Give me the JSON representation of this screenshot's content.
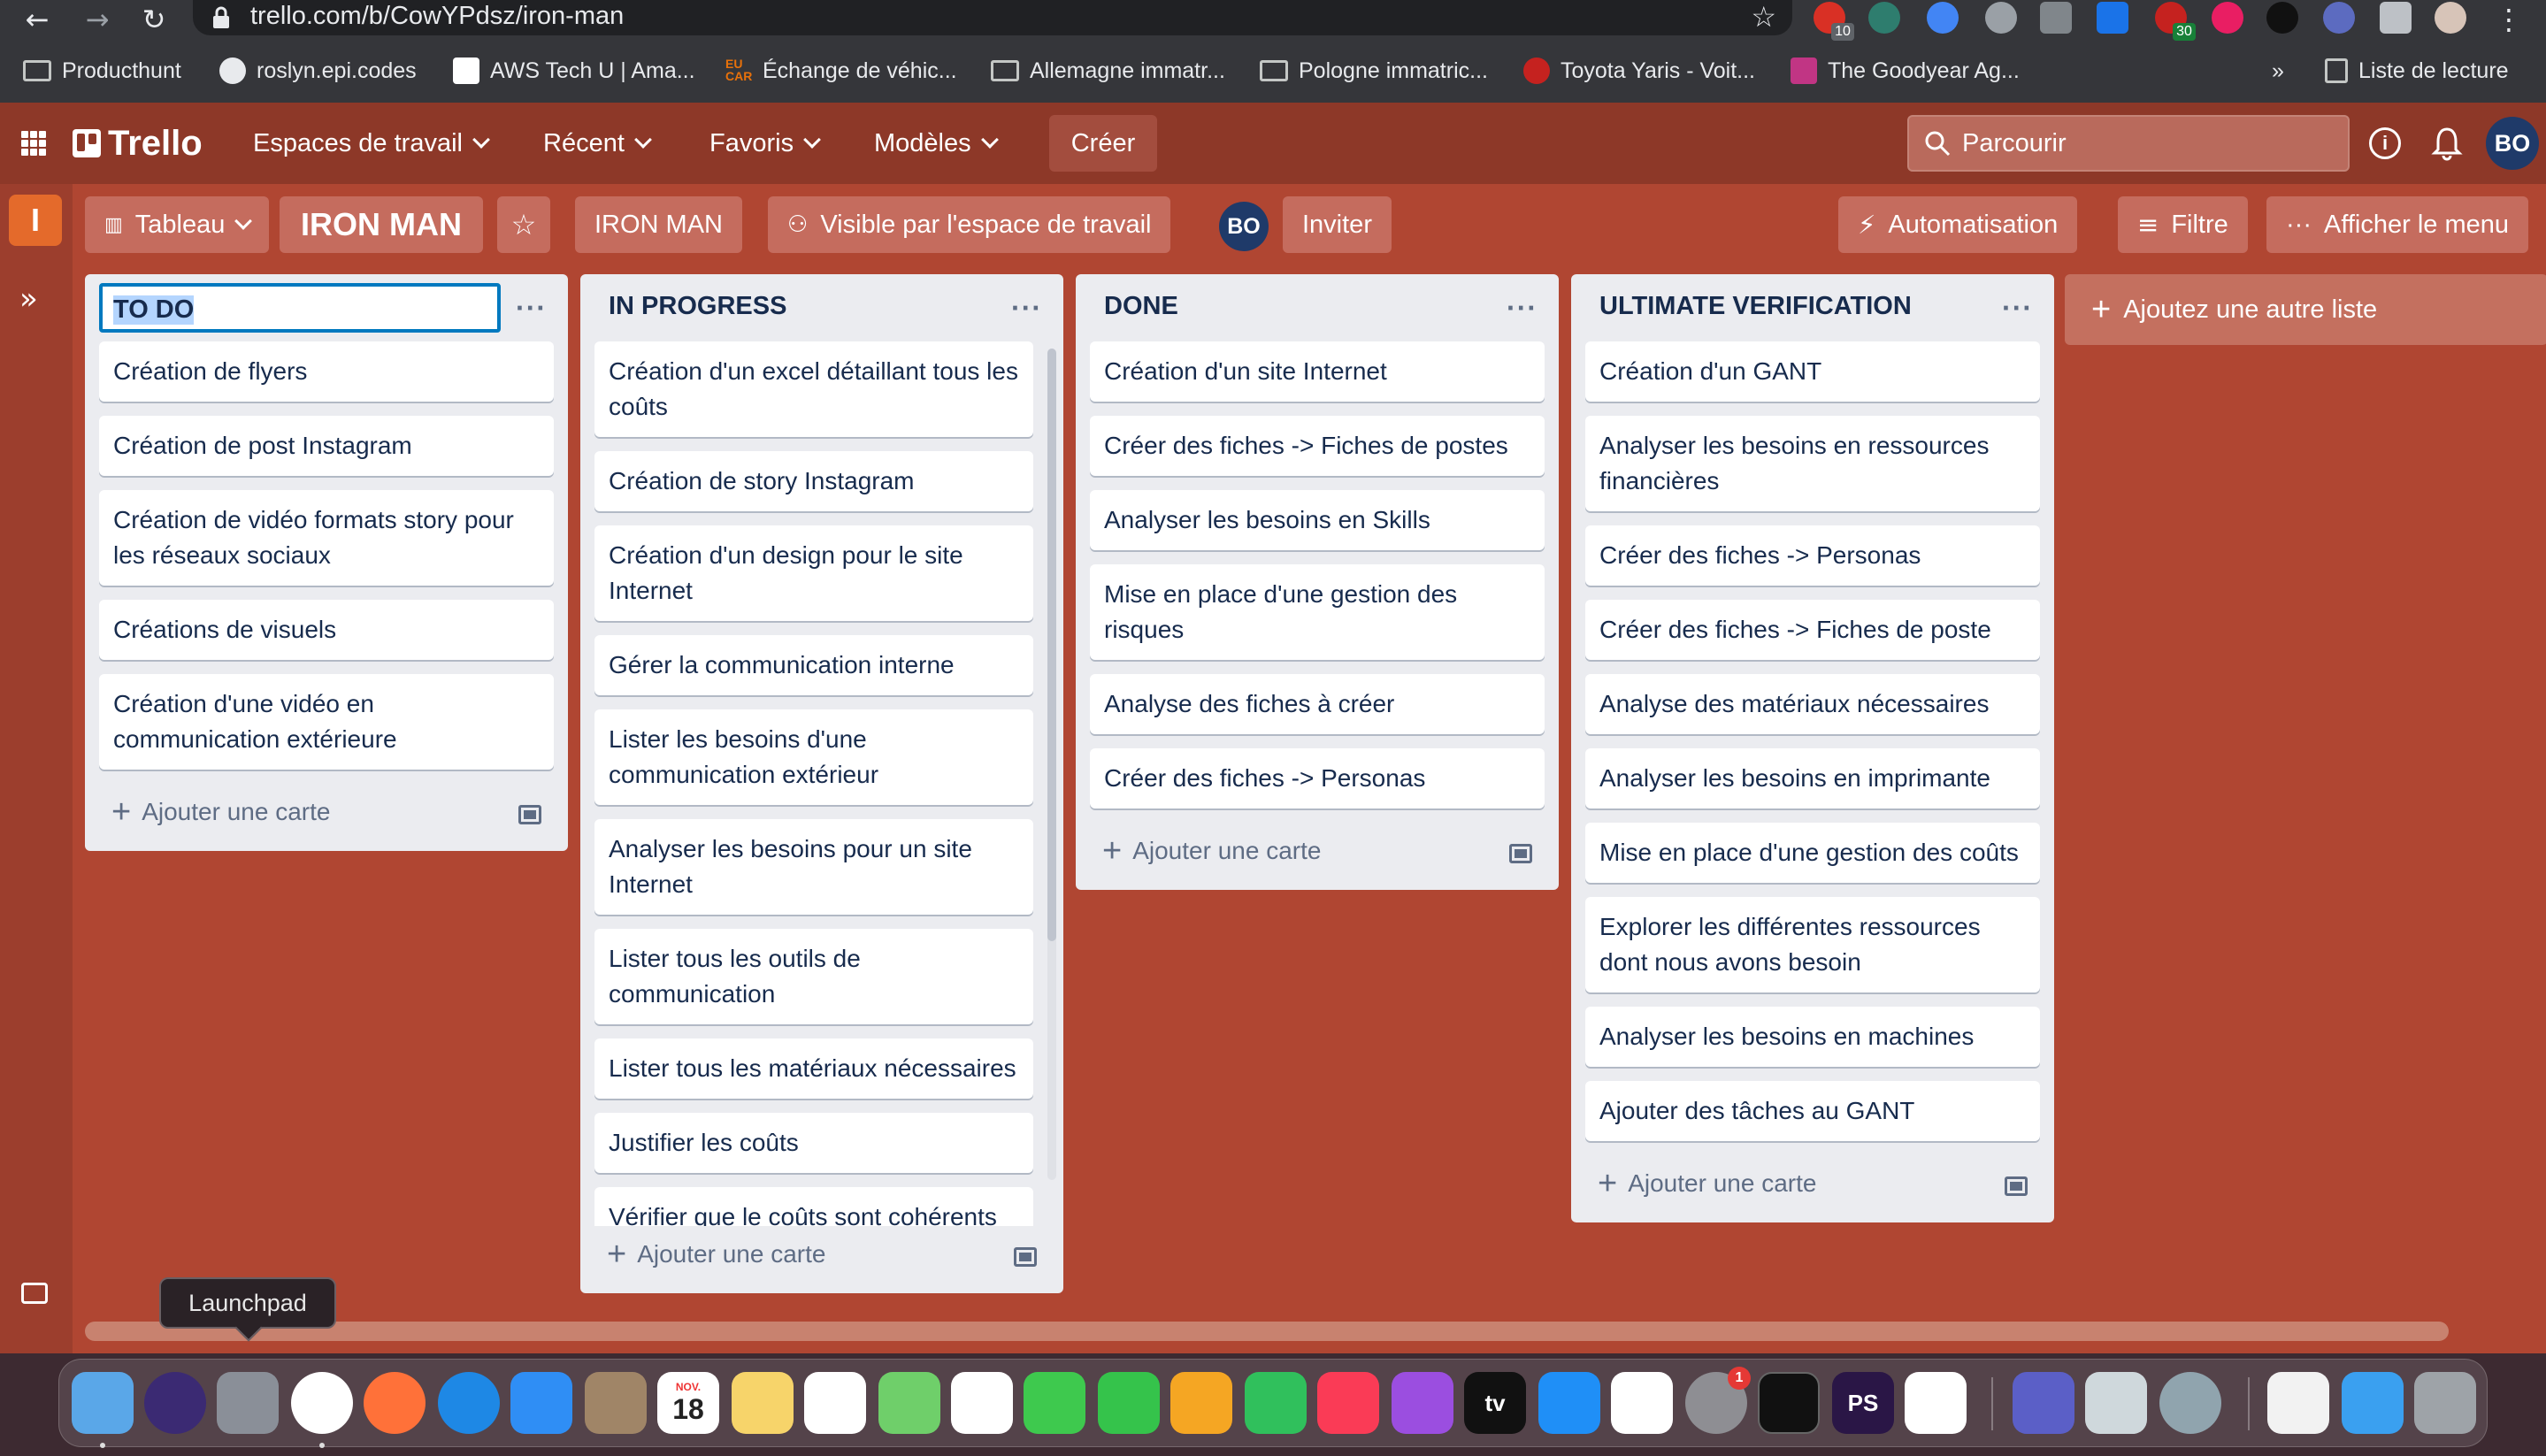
{
  "browser": {
    "url": "trello.com/b/CowYPdsz/iron-man",
    "extension_badges": [
      "10",
      "30"
    ],
    "bookmarks": [
      "Producthunt",
      "roslyn.epi.codes",
      "AWS Tech U | Ama...",
      "Échange de véhic...",
      "Allemagne immatr...",
      "Pologne immatric...",
      "Toyota Yaris - Voit...",
      "The Goodyear Ag..."
    ],
    "bookmarks_overflow": "»",
    "reading_list": "Liste de lecture",
    "eu_label": "EU\nCAR"
  },
  "nav": {
    "logo": "Trello",
    "menus": [
      "Espaces de travail",
      "Récent",
      "Favoris",
      "Modèles"
    ],
    "create": "Créer",
    "search_placeholder": "Parcourir",
    "avatar": "BO"
  },
  "sidebar": {
    "workspace_initial": "I"
  },
  "board": {
    "view": "Tableau",
    "title": "IRON MAN",
    "workspace": "IRON MAN",
    "visibility": "Visible par l'espace de travail",
    "member_avatar": "BO",
    "invite": "Inviter",
    "automation": "Automatisation",
    "filter": "Filtre",
    "show_menu": "Afficher le menu",
    "add_card_label": "Ajouter une carte",
    "add_list_label": "Ajoutez une autre liste",
    "lists": [
      {
        "title": "TO DO",
        "cards": [
          "Création de flyers",
          "Création de post Instagram",
          "Création de vidéo formats story pour les réseaux sociaux",
          "Créations de visuels",
          "Création d'une vidéo en communication extérieure"
        ]
      },
      {
        "title": "IN PROGRESS",
        "cards": [
          "Création d'un excel détaillant tous les coûts",
          "Création de story Instagram",
          "Création d'un design pour le site Internet",
          "Gérer la communication interne",
          "Lister les besoins d'une communication extérieur",
          "Analyser les besoins pour un site Internet",
          "Lister tous les outils de communication",
          "Lister tous les matériaux nécessaires",
          "Justifier les coûts",
          "Vérifier que le coûts sont cohérents"
        ]
      },
      {
        "title": "DONE",
        "cards": [
          "Création d'un site Internet",
          "Créer des fiches -> Fiches de postes",
          "Analyser les besoins en Skills",
          "Mise en place d'une gestion des risques",
          "Analyse des fiches à créer",
          "Créer des fiches -> Personas"
        ]
      },
      {
        "title": "ULTIMATE VERIFICATION",
        "cards": [
          "Création d'un GANT",
          "Analyser les besoins en ressources financières",
          "Créer des fiches -> Personas",
          "Créer des fiches -> Fiches de poste",
          "Analyse des matériaux nécessaires",
          "Analyser les besoins en imprimante",
          "Mise en place d'une gestion des coûts",
          "Explorer les différentes ressources dont nous avons besoin",
          "Analyser les besoins en machines",
          "Ajouter des tâches au GANT"
        ]
      }
    ]
  },
  "dock": {
    "tooltip": "Launchpad",
    "calendar_month": "NOV.",
    "calendar_day": "18",
    "tv_label": "tv",
    "ps_label": "PS",
    "system_prefs_badge": "1"
  }
}
